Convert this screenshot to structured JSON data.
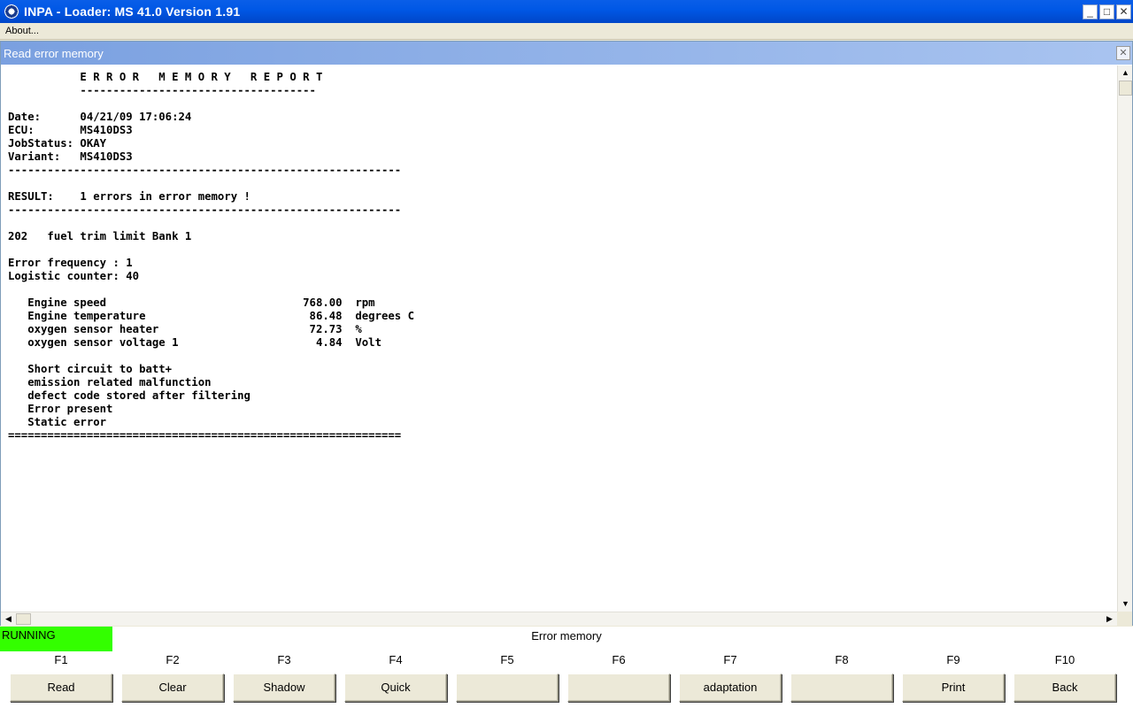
{
  "window": {
    "title": "INPA - Loader:  MS 41.0 Version 1.91",
    "minimize": "_",
    "maximize": "□",
    "close": "✕"
  },
  "menu": {
    "about": "About..."
  },
  "child_window": {
    "title": "Read error memory",
    "close": "✕"
  },
  "report_lines": [
    "           E R R O R   M E M O R Y   R E P O R T",
    "           ------------------------------------",
    "",
    "Date:      04/21/09 17:06:24",
    "ECU:       MS410DS3",
    "JobStatus: OKAY",
    "Variant:   MS410DS3",
    "------------------------------------------------------------",
    "",
    "RESULT:    1 errors in error memory !",
    "------------------------------------------------------------",
    "",
    "202   fuel trim limit Bank 1",
    "",
    "Error frequency : 1",
    "Logistic counter: 40",
    "",
    "   Engine speed                              768.00  rpm",
    "   Engine temperature                         86.48  degrees C",
    "   oxygen sensor heater                       72.73  %",
    "   oxygen sensor voltage 1                     4.84  Volt",
    "",
    "   Short circuit to batt+",
    "   emission related malfunction",
    "   defect code stored after filtering",
    "   Error present",
    "   Static error",
    "============================================================"
  ],
  "status": {
    "state": "RUNNING",
    "label": "Error memory",
    "state_color": "#33ff00"
  },
  "fkeys": [
    {
      "key": "F1",
      "label": "Read"
    },
    {
      "key": "F2",
      "label": "Clear"
    },
    {
      "key": "F3",
      "label": "Shadow"
    },
    {
      "key": "F4",
      "label": "Quick"
    },
    {
      "key": "F5",
      "label": ""
    },
    {
      "key": "F6",
      "label": ""
    },
    {
      "key": "F7",
      "label": "adaptation"
    },
    {
      "key": "F8",
      "label": ""
    },
    {
      "key": "F9",
      "label": "Print"
    },
    {
      "key": "F10",
      "label": "Back"
    }
  ]
}
